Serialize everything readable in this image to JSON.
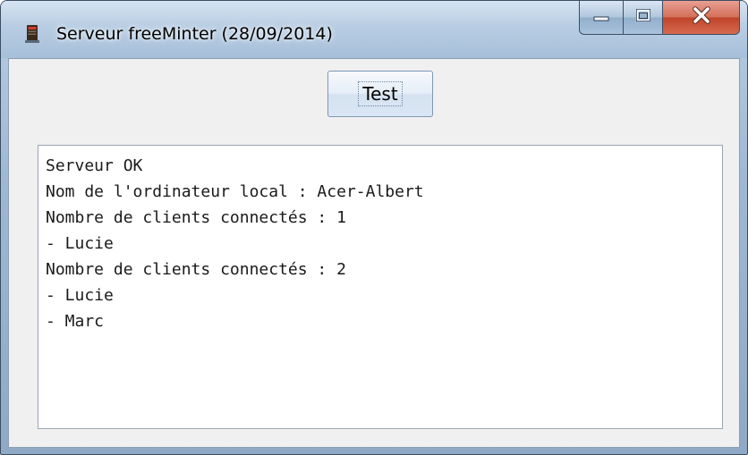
{
  "window": {
    "title": "Serveur freeMinter (28/09/2014)",
    "icons": {
      "app": "server-app-icon",
      "minimize": "minimize-icon",
      "maximize": "maximize-icon",
      "close": "close-icon"
    },
    "colors": {
      "titlebar": "#b8cde3",
      "close_button": "#c0442a",
      "client_background": "#f0f0f0"
    }
  },
  "toolbar": {
    "test_label": "Test"
  },
  "output": {
    "lines": [
      "Serveur OK",
      "Nom de l'ordinateur local : Acer-Albert",
      "Nombre de clients connectés : 1",
      "- Lucie",
      "Nombre de clients connectés : 2",
      "- Lucie",
      "- Marc"
    ]
  }
}
